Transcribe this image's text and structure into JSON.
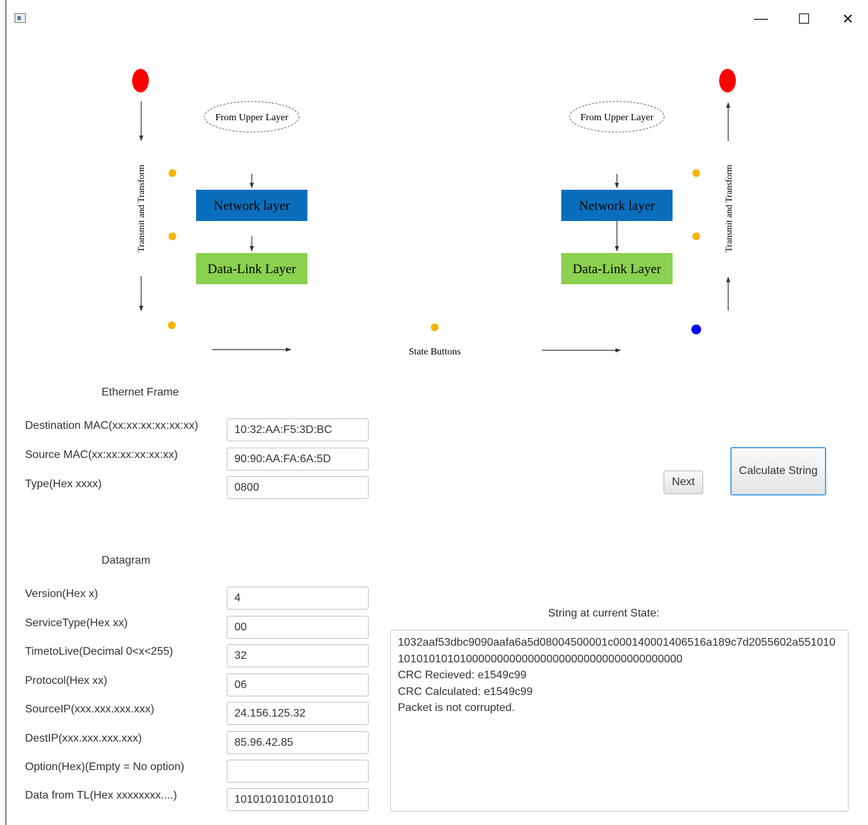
{
  "window": {
    "minimize_glyph": "—",
    "maximize_glyph": "☐",
    "close_glyph": "✕"
  },
  "diagram": {
    "sender": {
      "upper_layer_label": "From Upper Layer",
      "network_layer_label": "Network layer",
      "datalink_layer_label": "Data-Link Layer",
      "transmit_label": "Transmit and Transform"
    },
    "receiver": {
      "upper_layer_label": "From Upper Layer",
      "network_layer_label": "Network layer",
      "datalink_layer_label": "Data-Link Layer",
      "transmit_label": "Transmit and Transform"
    },
    "state_buttons_label": "State Buttons",
    "colors": {
      "network_layer": "#0a6ebd",
      "datalink_layer": "#8bd04e",
      "endpoint": "#ff0000",
      "state_dot": "#f5b400",
      "active_state_dot": "#0000ff"
    }
  },
  "ethernet_frame": {
    "title": "Ethernet Frame",
    "fields": [
      {
        "label": "Destination MAC(xx:xx:xx:xx:xx:xx)",
        "value": "10:32:AA:F5:3D:BC"
      },
      {
        "label": "Source MAC(xx:xx:xx:xx:xx:xx)",
        "value": "90:90:AA:FA:6A:5D"
      },
      {
        "label": "Type(Hex xxxx)",
        "value": "0800"
      }
    ]
  },
  "datagram": {
    "title": "Datagram",
    "fields": [
      {
        "label": "Version(Hex x)",
        "value": "4"
      },
      {
        "label": "ServiceType(Hex xx)",
        "value": "00"
      },
      {
        "label": "TimetoLive(Decimal 0<x<255)",
        "value": "32"
      },
      {
        "label": "Protocol(Hex xx)",
        "value": "06"
      },
      {
        "label": "SourceIP(xxx.xxx.xxx.xxx)",
        "value": "24.156.125.32"
      },
      {
        "label": "DestIP(xxx.xxx.xxx.xxx)",
        "value": "85.96.42.85"
      },
      {
        "label": "Option(Hex)(Empty = No option)",
        "value": ""
      },
      {
        "label": "Data from TL(Hex xxxxxxxx....)",
        "value": "1010101010101010"
      }
    ]
  },
  "buttons": {
    "next_label": "Next",
    "calculate_label": "Calculate String"
  },
  "output": {
    "title": "String at current State:",
    "lines": [
      "1032aaf53dbc9090aafa6a5d08004500001c000140001406516a189c7d2055602a551010",
      "1010101010100000000000000000000000000000000000",
      "CRC Recieved: e1549c99",
      "CRC Calculated: e1549c99",
      "Packet is not corrupted."
    ]
  }
}
